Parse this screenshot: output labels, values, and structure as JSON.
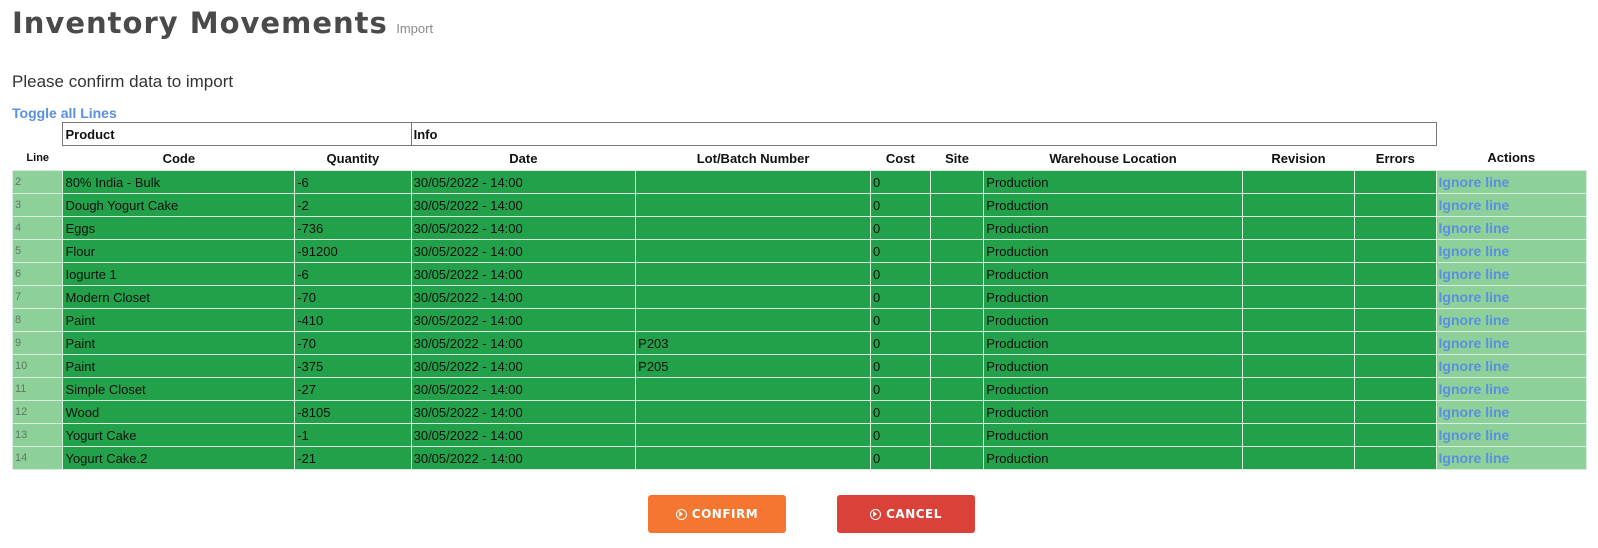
{
  "header": {
    "title": "Inventory Movements",
    "subtitle": "Import"
  },
  "instructions": "Please confirm data to import",
  "toggle_label": "Toggle all Lines",
  "groups": {
    "product": "Product",
    "info": "Info"
  },
  "columns": {
    "line": "Line",
    "code": "Code",
    "quantity": "Quantity",
    "date": "Date",
    "lot": "Lot/Batch Number",
    "cost": "Cost",
    "site": "Site",
    "warehouse": "Warehouse Location",
    "revision": "Revision",
    "errors": "Errors",
    "actions": "Actions"
  },
  "rows": [
    {
      "line": "2",
      "code": "80% India - Bulk",
      "quantity": "-6",
      "date": "30/05/2022 - 14:00",
      "lot": "",
      "cost": "0",
      "site": "",
      "warehouse": "Production",
      "revision": "",
      "errors": "",
      "action": "Ignore line"
    },
    {
      "line": "3",
      "code": "Dough Yogurt Cake",
      "quantity": "-2",
      "date": "30/05/2022 - 14:00",
      "lot": "",
      "cost": "0",
      "site": "",
      "warehouse": "Production",
      "revision": "",
      "errors": "",
      "action": "Ignore line"
    },
    {
      "line": "4",
      "code": "Eggs",
      "quantity": "-736",
      "date": "30/05/2022 - 14:00",
      "lot": "",
      "cost": "0",
      "site": "",
      "warehouse": "Production",
      "revision": "",
      "errors": "",
      "action": "Ignore line"
    },
    {
      "line": "5",
      "code": "Flour",
      "quantity": "-91200",
      "date": "30/05/2022 - 14:00",
      "lot": "",
      "cost": "0",
      "site": "",
      "warehouse": "Production",
      "revision": "",
      "errors": "",
      "action": "Ignore line"
    },
    {
      "line": "6",
      "code": "Iogurte 1",
      "quantity": "-6",
      "date": "30/05/2022 - 14:00",
      "lot": "",
      "cost": "0",
      "site": "",
      "warehouse": "Production",
      "revision": "",
      "errors": "",
      "action": "Ignore line"
    },
    {
      "line": "7",
      "code": "Modern Closet",
      "quantity": "-70",
      "date": "30/05/2022 - 14:00",
      "lot": "",
      "cost": "0",
      "site": "",
      "warehouse": "Production",
      "revision": "",
      "errors": "",
      "action": "Ignore line"
    },
    {
      "line": "8",
      "code": "Paint",
      "quantity": "-410",
      "date": "30/05/2022 - 14:00",
      "lot": "",
      "cost": "0",
      "site": "",
      "warehouse": "Production",
      "revision": "",
      "errors": "",
      "action": "Ignore line"
    },
    {
      "line": "9",
      "code": "Paint",
      "quantity": "-70",
      "date": "30/05/2022 - 14:00",
      "lot": "P203",
      "cost": "0",
      "site": "",
      "warehouse": "Production",
      "revision": "",
      "errors": "",
      "action": "Ignore line"
    },
    {
      "line": "10",
      "code": "Paint",
      "quantity": "-375",
      "date": "30/05/2022 - 14:00",
      "lot": "P205",
      "cost": "0",
      "site": "",
      "warehouse": "Production",
      "revision": "",
      "errors": "",
      "action": "Ignore line"
    },
    {
      "line": "11",
      "code": "Simple Closet",
      "quantity": "-27",
      "date": "30/05/2022 - 14:00",
      "lot": "",
      "cost": "0",
      "site": "",
      "warehouse": "Production",
      "revision": "",
      "errors": "",
      "action": "Ignore line"
    },
    {
      "line": "12",
      "code": "Wood",
      "quantity": "-8105",
      "date": "30/05/2022 - 14:00",
      "lot": "",
      "cost": "0",
      "site": "",
      "warehouse": "Production",
      "revision": "",
      "errors": "",
      "action": "Ignore line"
    },
    {
      "line": "13",
      "code": "Yogurt Cake",
      "quantity": "-1",
      "date": "30/05/2022 - 14:00",
      "lot": "",
      "cost": "0",
      "site": "",
      "warehouse": "Production",
      "revision": "",
      "errors": "",
      "action": "Ignore line"
    },
    {
      "line": "14",
      "code": "Yogurt Cake.2",
      "quantity": "-21",
      "date": "30/05/2022 - 14:00",
      "lot": "",
      "cost": "0",
      "site": "",
      "warehouse": "Production",
      "revision": "",
      "errors": "",
      "action": "Ignore line"
    }
  ],
  "buttons": {
    "confirm": "CONFIRM",
    "cancel": "CANCEL",
    "confirm_icon": "circle-arrow-right-icon",
    "cancel_icon": "circle-arrow-right-icon"
  },
  "colors": {
    "valid_row": "#22a14a",
    "row_side": "#8dd09a",
    "link": "#5b8fe0",
    "confirm": "#f57630",
    "cancel": "#d94139"
  }
}
